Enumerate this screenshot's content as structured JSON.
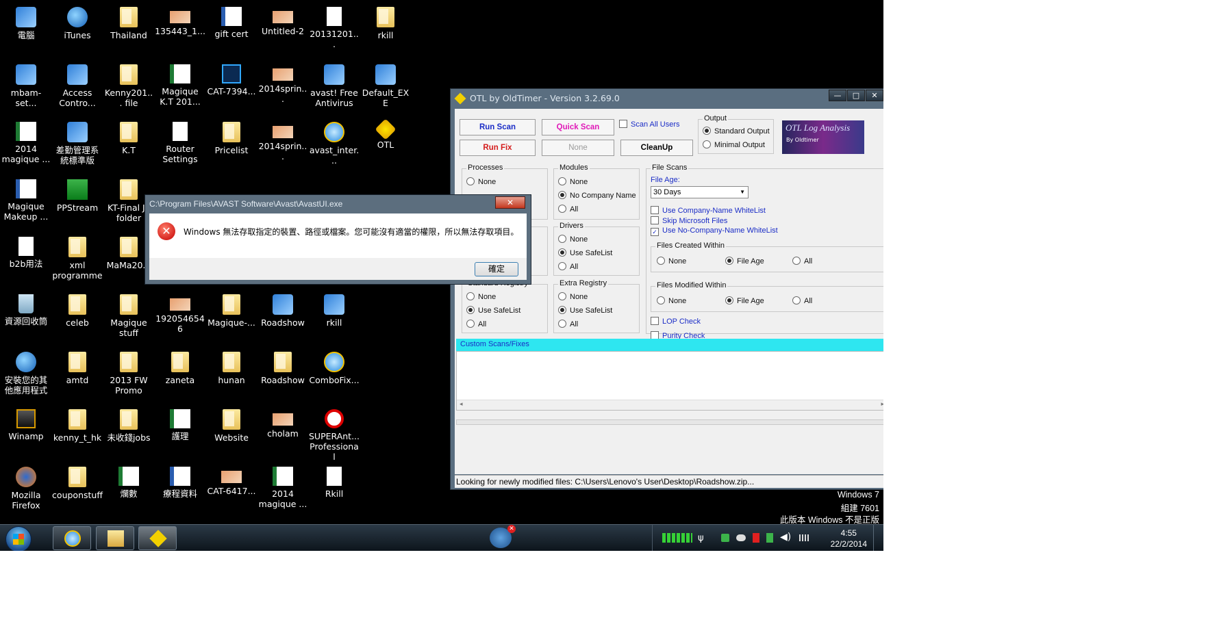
{
  "desktop": {
    "icons": [
      {
        "label": "電腦",
        "type": "app"
      },
      {
        "label": "iTunes",
        "type": "round"
      },
      {
        "label": "Thailand",
        "type": "folder"
      },
      {
        "label": "135443_1...",
        "type": "img"
      },
      {
        "label": "gift cert",
        "type": "word"
      },
      {
        "label": "Untitled-2",
        "type": "img"
      },
      {
        "label": "20131201...",
        "type": "doc"
      },
      {
        "label": "rkill",
        "type": "folder"
      },
      {
        "label": "mbam-set...",
        "type": "app"
      },
      {
        "label": "Access Contro...",
        "type": "app"
      },
      {
        "label": "Kenny201... file",
        "type": "folder"
      },
      {
        "label": "Magique K.T 201...",
        "type": "excel"
      },
      {
        "label": "CAT-7394...",
        "type": "ps"
      },
      {
        "label": "2014sprin...",
        "type": "img"
      },
      {
        "label": "avast! Free Antivirus",
        "type": "app"
      },
      {
        "label": "Default_EXE",
        "type": "app"
      },
      {
        "label": "2014 magique ...",
        "type": "excel"
      },
      {
        "label": "差勤管理系統標準版",
        "type": "app"
      },
      {
        "label": "K.T",
        "type": "folder"
      },
      {
        "label": "Router Settings",
        "type": "doc"
      },
      {
        "label": "Pricelist",
        "type": "folder"
      },
      {
        "label": "2014sprin...",
        "type": "img"
      },
      {
        "label": "avast_inter...",
        "type": "ie"
      },
      {
        "label": "OTL",
        "type": "otl"
      },
      {
        "label": "Magique Makeup ...",
        "type": "word"
      },
      {
        "label": "PPStream",
        "type": "pps"
      },
      {
        "label": "KT-Final JF folder",
        "type": "folder"
      },
      {
        "label": "b2b用法",
        "type": "doc"
      },
      {
        "label": "xml programme",
        "type": "folder"
      },
      {
        "label": "MaMa20...",
        "type": "folder"
      },
      {
        "label": "資源回收筒",
        "type": "recycle"
      },
      {
        "label": "celeb",
        "type": "folder"
      },
      {
        "label": "Magique stuff",
        "type": "folder"
      },
      {
        "label": "1920546546",
        "type": "img"
      },
      {
        "label": "Magique-...",
        "type": "folder"
      },
      {
        "label": "Roadshow",
        "type": "app"
      },
      {
        "label": "rkill",
        "type": "app"
      },
      {
        "label": "安裝您的其他應用程式",
        "type": "round"
      },
      {
        "label": "amtd",
        "type": "folder"
      },
      {
        "label": "2013 FW Promo",
        "type": "folder"
      },
      {
        "label": "zaneta",
        "type": "folder"
      },
      {
        "label": "hunan",
        "type": "folder"
      },
      {
        "label": "Roadshow",
        "type": "folder"
      },
      {
        "label": "ComboFix...",
        "type": "ie"
      },
      {
        "label": "Winamp",
        "type": "winamp"
      },
      {
        "label": "kenny_t_hk",
        "type": "folder"
      },
      {
        "label": "未收錢jobs",
        "type": "folder"
      },
      {
        "label": "護理",
        "type": "excel"
      },
      {
        "label": "Website",
        "type": "folder"
      },
      {
        "label": "cholam",
        "type": "img"
      },
      {
        "label": "SUPERAnt... Professional",
        "type": "no"
      },
      {
        "label": "Mozilla Firefox",
        "type": "ff"
      },
      {
        "label": "couponstuff",
        "type": "folder"
      },
      {
        "label": "爛數",
        "type": "excel"
      },
      {
        "label": "療程資料",
        "type": "word"
      },
      {
        "label": "CAT-6417...",
        "type": "img"
      },
      {
        "label": "2014 magique ...",
        "type": "excel"
      },
      {
        "label": "Rkill",
        "type": "doc"
      }
    ]
  },
  "otl": {
    "title": "OTL by OldTimer - Version 3.2.69.0",
    "window_buttons": [
      "—",
      "□",
      "✕"
    ],
    "buttons": {
      "run_scan": "Run Scan",
      "quick_scan": "Quick Scan",
      "run_fix": "Run Fix",
      "none": "None",
      "cleanup": "CleanUp"
    },
    "scan_all_users": "Scan All Users",
    "output": {
      "title": "Output",
      "standard": "Standard Output",
      "minimal": "Minimal Output"
    },
    "banner": {
      "title": "OTL Log Analysis",
      "by": "By Oldtimer"
    },
    "processes": {
      "title": "Processes",
      "none": "None"
    },
    "modules": {
      "title": "Modules",
      "none": "None",
      "no_company": "No Company Name",
      "all": "All"
    },
    "drivers": {
      "title": "Drivers",
      "none": "None",
      "safelist": "Use SafeList",
      "all": "All"
    },
    "std_registry": {
      "title": "Standard Registry",
      "none": "None",
      "safelist": "Use SafeList",
      "all": "All"
    },
    "extra_registry": {
      "title": "Extra Registry",
      "none": "None",
      "safelist": "Use SafeList",
      "all": "All"
    },
    "file_scans": {
      "title": "File Scans",
      "file_age_label": "File Age:",
      "file_age_value": "30 Days",
      "company_whitelist": "Use Company-Name WhiteList",
      "skip_ms": "Skip Microsoft Files",
      "no_company_whitelist": "Use No-Company-Name WhiteList"
    },
    "created_within": {
      "title": "Files Created Within",
      "none": "None",
      "file_age": "File Age",
      "all": "All"
    },
    "modified_within": {
      "title": "Files Modified Within",
      "none": "None",
      "file_age": "File Age",
      "all": "All"
    },
    "lop_check": "LOP Check",
    "purity_check": "Purity Check",
    "custom_header": "Custom Scans/Fixes",
    "status": "Looking for newly modified files: C:\\Users\\Lenovo's User\\Desktop\\Roadshow.zip..."
  },
  "dialog": {
    "title": "C:\\Program Files\\AVAST Software\\Avast\\AvastUI.exe",
    "close": "✕",
    "icon": "✕",
    "message": "Windows 無法存取指定的裝置、路徑或檔案。您可能沒有適當的權限，所以無法存取項目。",
    "ok": "確定"
  },
  "watermark": {
    "line1": "Windows 7",
    "line2": "組建 7601",
    "line3": "此版本 Windows 不是正版"
  },
  "taskbar": {
    "clock_time": "4:55",
    "clock_date": "22/2/2014"
  },
  "colors": {
    "desktop": "#000000",
    "otl_accent_red": "#d41c1c",
    "otl_accent_blue": "#1a2cc6",
    "custom_bar": "#2ee6f0"
  }
}
